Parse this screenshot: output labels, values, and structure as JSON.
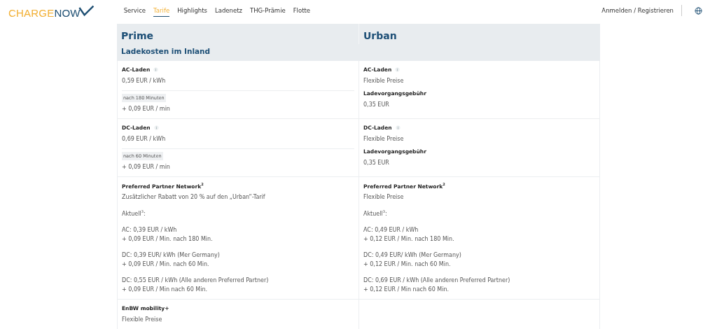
{
  "header": {
    "logo": {
      "part_1": "CHARGE",
      "part_2": "NOW"
    },
    "nav": [
      {
        "label": "Service",
        "selected": false
      },
      {
        "label": "Tarife",
        "selected": true
      },
      {
        "label": "Highlights",
        "selected": false
      },
      {
        "label": "Ladenetz",
        "selected": false
      },
      {
        "label": "THG-Prämie",
        "selected": false
      },
      {
        "label": "Flotte",
        "selected": false
      }
    ],
    "login": "Anmelden / Registrieren"
  },
  "plans": [
    "Prime",
    "Urban"
  ],
  "subtitle": "Ladekosten im Inland",
  "sections": [
    {
      "cells": [
        [
          {
            "kind": "heading",
            "text": "AC-Laden",
            "info": true
          },
          {
            "kind": "text",
            "text": "0,59 EUR / kWh"
          },
          {
            "kind": "rule"
          },
          {
            "kind": "tag",
            "text": "nach 180 Minuten"
          },
          {
            "kind": "text",
            "text": "+ 0,09 EUR / min"
          }
        ],
        [
          {
            "kind": "heading",
            "text": "AC-Laden",
            "info": true
          },
          {
            "kind": "text",
            "text": "Flexible Preise"
          },
          {
            "kind": "heading",
            "text": "Ladevorgangsgebühr",
            "info": false
          },
          {
            "kind": "text",
            "text": "0,35 EUR"
          }
        ]
      ]
    },
    {
      "cells": [
        [
          {
            "kind": "heading",
            "text": "DC-Laden",
            "info": true
          },
          {
            "kind": "text",
            "text": "0,69 EUR / kWh"
          },
          {
            "kind": "rule"
          },
          {
            "kind": "tag",
            "text": "nach 60 Minuten"
          },
          {
            "kind": "text",
            "text": "+ 0,09 EUR / min"
          }
        ],
        [
          {
            "kind": "heading",
            "text": "DC-Laden",
            "info": true
          },
          {
            "kind": "text",
            "text": "Flexible Preise"
          },
          {
            "kind": "heading",
            "text": "Ladevorgangsgebühr",
            "info": false
          },
          {
            "kind": "text",
            "text": "0,35 EUR"
          }
        ]
      ]
    },
    {
      "cells": [
        [
          {
            "kind": "heading",
            "text": "Preferred Partner Network$^{2}$",
            "info": false
          },
          {
            "kind": "text",
            "text": "Zusätzlicher Rabatt von 20 % auf den „Urban“-Tarif"
          },
          {
            "kind": "gap"
          },
          {
            "kind": "text",
            "text": "Aktuell$^{3}$:"
          },
          {
            "kind": "gap"
          },
          {
            "kind": "text",
            "text": "AC: 0,39 EUR / kWh\n+ 0,09 EUR / Min. nach 180 Min."
          },
          {
            "kind": "gap"
          },
          {
            "kind": "text",
            "text": "DC: 0,39 EUR/ kWh (Mer Germany)\n+ 0,09 EUR / Min. nach 60 Min."
          },
          {
            "kind": "gap"
          },
          {
            "kind": "text",
            "text": "DC: 0,55 EUR / kWh (Alle anderen Preferred Partner)\n+ 0,09 EUR / Min nach 60 Min."
          }
        ],
        [
          {
            "kind": "heading",
            "text": "Preferred Partner Network$^{2}$",
            "info": false
          },
          {
            "kind": "text",
            "text": "Flexible Preise"
          },
          {
            "kind": "gap"
          },
          {
            "kind": "text",
            "text": "Aktuell$^{3}$:"
          },
          {
            "kind": "gap"
          },
          {
            "kind": "text",
            "text": "AC: 0,49 EUR / kWh\n+ 0,12 EUR / Min. nach 180 Min."
          },
          {
            "kind": "gap"
          },
          {
            "kind": "text",
            "text": "DC: 0,49 EUR/ kWh (Mer Germany)\n+ 0,12 EUR / Min. nach 60 Min."
          },
          {
            "kind": "gap"
          },
          {
            "kind": "text",
            "text": "DC: 0,69 EUR / kWh (Alle anderen Preferred Partner)\n+ 0,12 EUR / Min nach 60 Min."
          }
        ]
      ]
    },
    {
      "cells": [
        [
          {
            "kind": "heading",
            "text": "EnBW mobility+",
            "info": false
          },
          {
            "kind": "text",
            "text": "Flexible Preise"
          }
        ],
        []
      ]
    }
  ]
}
